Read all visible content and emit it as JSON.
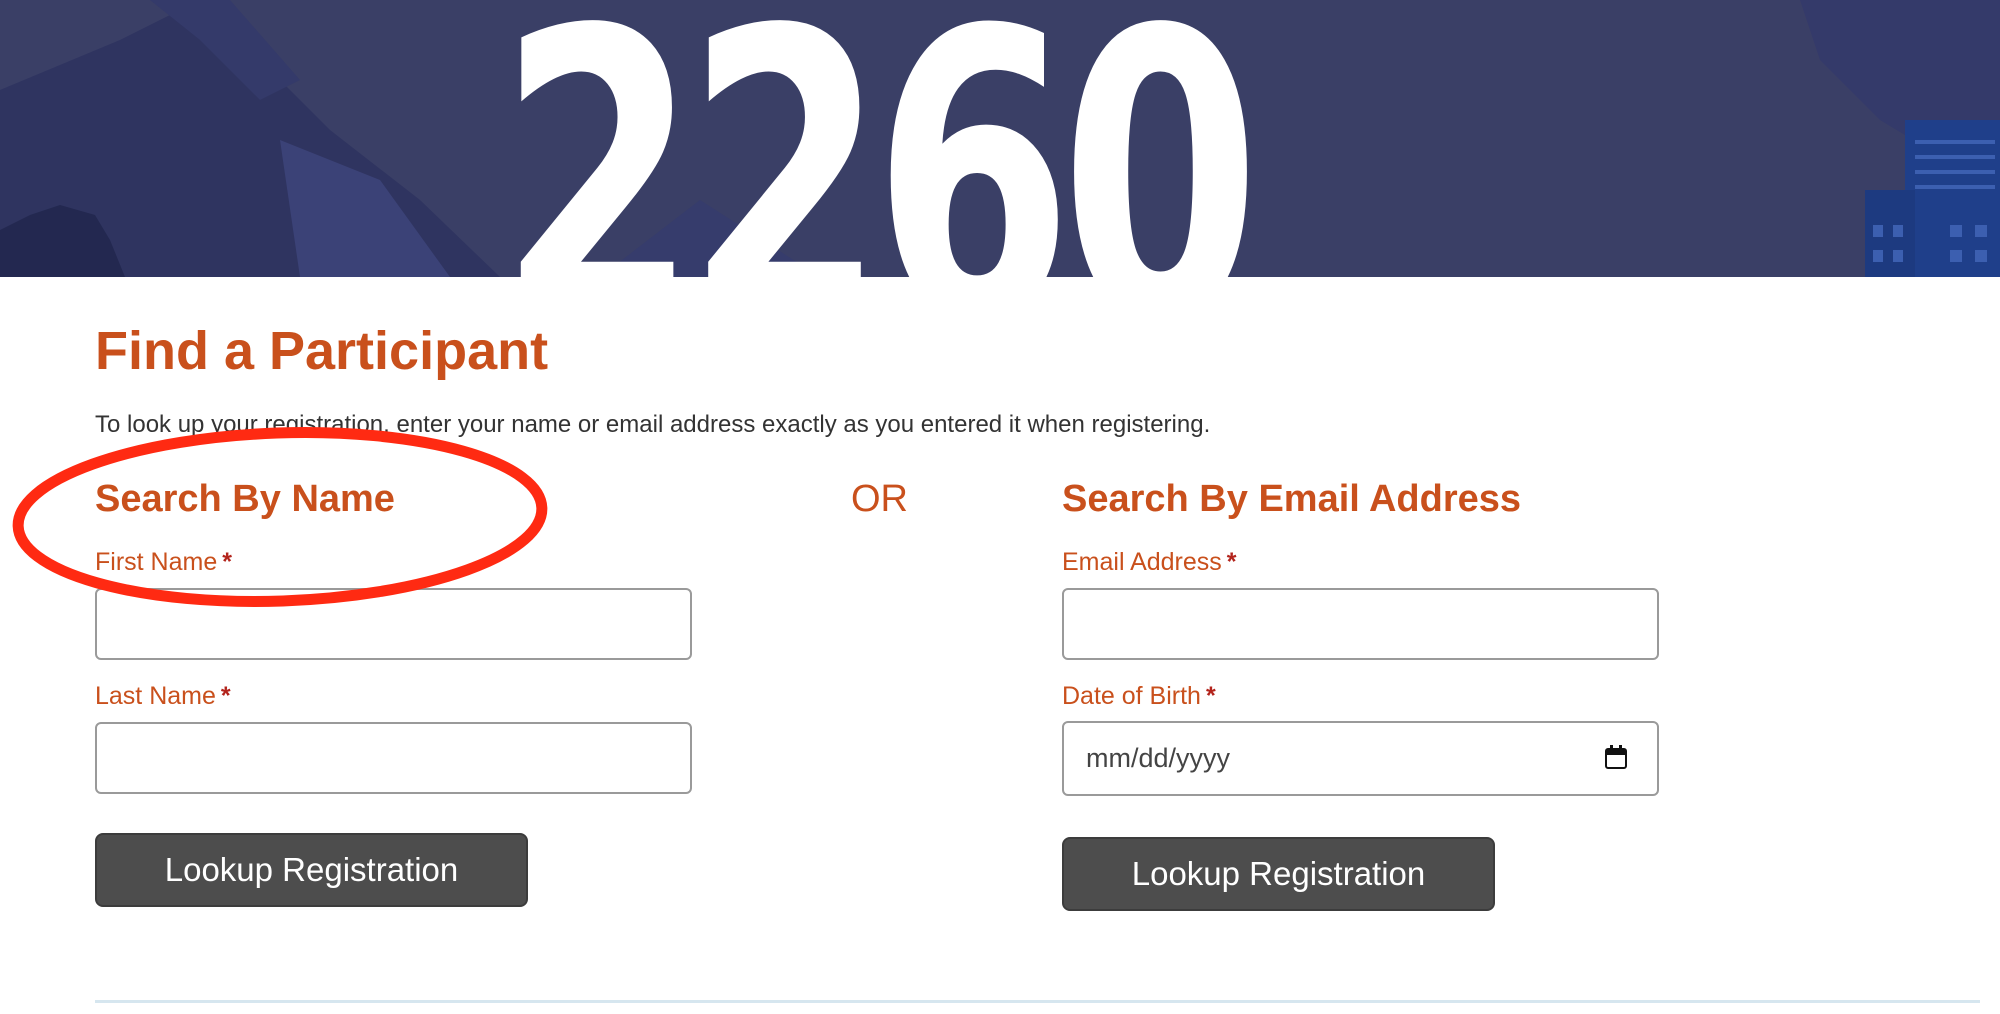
{
  "banner": {
    "headline": "2260",
    "colors": {
      "background": "#3a3f66",
      "mountain": "#2f3460",
      "dark": "#232850",
      "building": "#1f3f8a",
      "text": "#ffffff"
    }
  },
  "page": {
    "title": "Find a Participant",
    "instructions": "To look up your registration, enter your name or email address exactly as you entered it when registering."
  },
  "name_search": {
    "heading": "Search By Name",
    "first_name_label": "First Name",
    "first_name_value": "",
    "last_name_label": "Last Name",
    "last_name_value": "",
    "required_marker": "*",
    "button_label": "Lookup Registration"
  },
  "separator": {
    "label": "OR"
  },
  "email_search": {
    "heading": "Search By Email Address",
    "email_label": "Email Address",
    "email_value": "",
    "dob_label": "Date of Birth",
    "dob_placeholder": "mm/dd/yyyy",
    "required_marker": "*",
    "button_label": "Lookup Registration",
    "calendar_icon": "calendar-icon"
  },
  "theme": {
    "accent": "#c9501c",
    "required": "#b3241c",
    "button": "#4d4d4d",
    "annotation": "#ff2a12"
  }
}
